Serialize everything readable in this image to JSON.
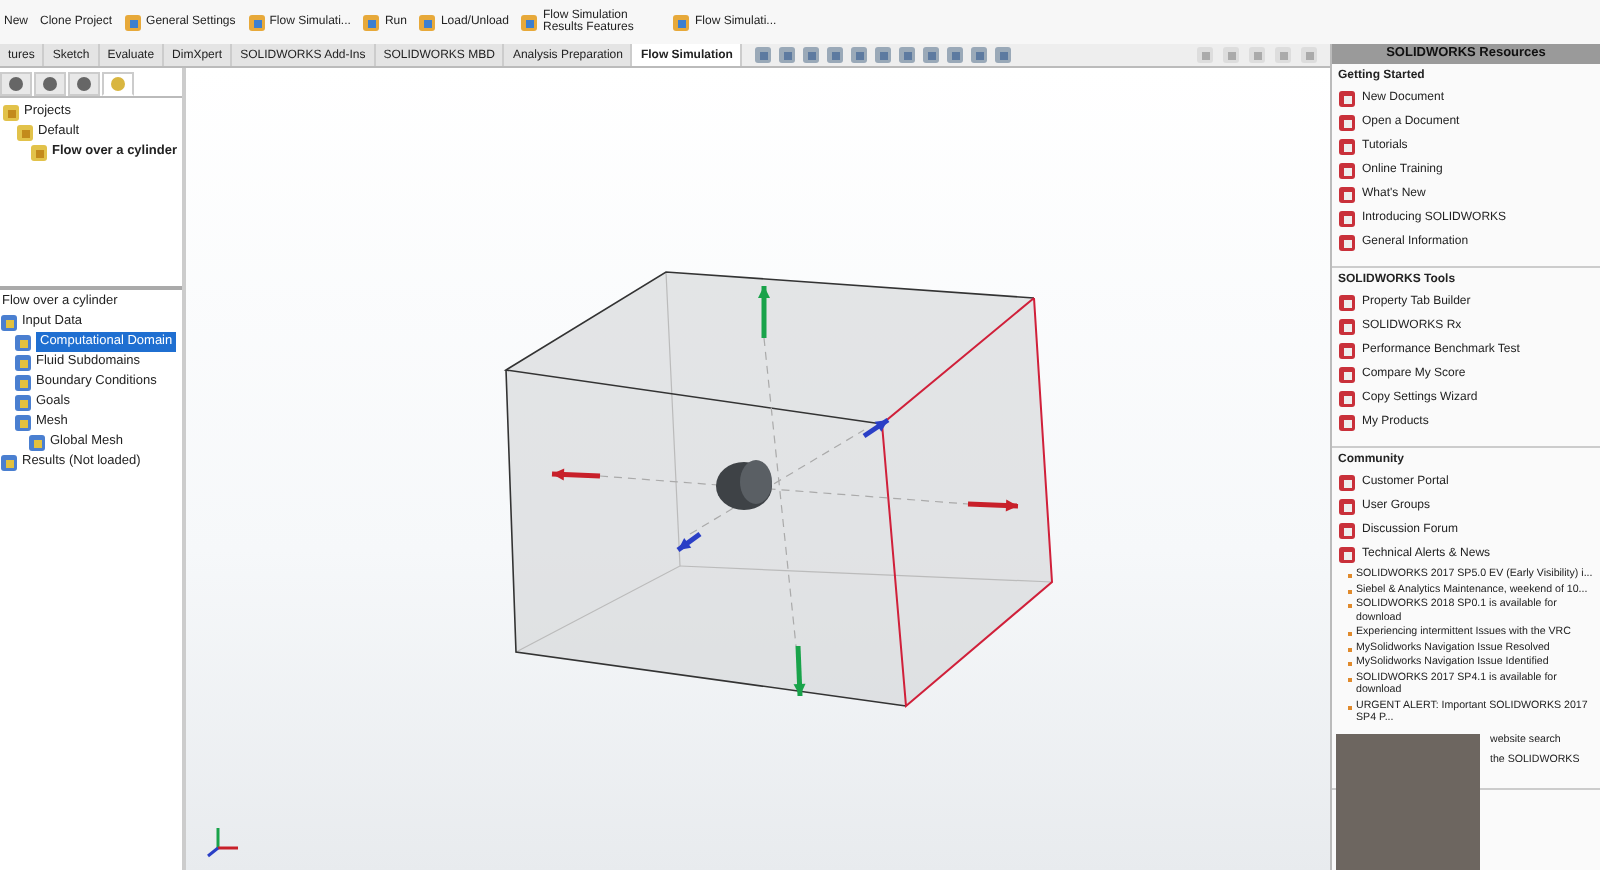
{
  "ribbon": {
    "commands": [
      {
        "label": "New",
        "kind": "small"
      },
      {
        "label": "Clone Project",
        "kind": "small"
      },
      {
        "label": "General Settings",
        "kind": "large"
      },
      {
        "label": "Flow Simulati...",
        "kind": "large"
      },
      {
        "label": "Run",
        "kind": "large"
      },
      {
        "label": "Load/Unload",
        "kind": "large"
      },
      {
        "label": "Flow Simulation Results Features",
        "kind": "large"
      },
      {
        "label": "Flow Simulati...",
        "kind": "large"
      }
    ]
  },
  "tabs": [
    {
      "label": "tures",
      "selected": false
    },
    {
      "label": "Sketch",
      "selected": false
    },
    {
      "label": "Evaluate",
      "selected": false
    },
    {
      "label": "DimXpert",
      "selected": false
    },
    {
      "label": "SOLIDWORKS Add-Ins",
      "selected": false
    },
    {
      "label": "SOLIDWORKS MBD",
      "selected": false
    },
    {
      "label": "Analysis Preparation",
      "selected": false
    },
    {
      "label": "Flow Simulation",
      "selected": true
    }
  ],
  "panel_tabs": [
    {
      "selected": false
    },
    {
      "selected": false
    },
    {
      "selected": false
    },
    {
      "selected": true
    }
  ],
  "projects_tree": [
    {
      "label": "Projects",
      "active": false,
      "children": [
        {
          "label": "Default",
          "active": false,
          "children": [
            {
              "label": "Flow over a cylinder",
              "active": true
            }
          ]
        }
      ]
    }
  ],
  "analysis_tree": {
    "title": "Flow over a cylinder",
    "items": [
      {
        "label": "Input Data",
        "selected": false,
        "children": [
          {
            "label": "Computational Domain",
            "selected": true
          },
          {
            "label": "Fluid Subdomains",
            "selected": false
          },
          {
            "label": "Boundary Conditions",
            "selected": false
          },
          {
            "label": "Goals",
            "selected": false
          },
          {
            "label": "Mesh",
            "selected": false,
            "children": [
              {
                "label": "Global Mesh",
                "selected": false
              }
            ]
          }
        ]
      },
      {
        "label": "Results (Not loaded)",
        "selected": false
      }
    ]
  },
  "resources": {
    "title": "SOLIDWORKS Resources",
    "sections": [
      {
        "title": "Getting Started",
        "items": [
          {
            "label": "New Document"
          },
          {
            "label": "Open a Document"
          },
          {
            "label": "Tutorials"
          },
          {
            "label": "Online Training"
          },
          {
            "label": "What's New"
          },
          {
            "label": "Introducing SOLIDWORKS"
          },
          {
            "label": "General Information"
          }
        ]
      },
      {
        "title": "SOLIDWORKS Tools",
        "items": [
          {
            "label": "Property Tab Builder"
          },
          {
            "label": "SOLIDWORKS Rx"
          },
          {
            "label": "Performance Benchmark Test"
          },
          {
            "label": "Compare My Score"
          },
          {
            "label": "Copy Settings Wizard"
          },
          {
            "label": "My Products"
          }
        ]
      },
      {
        "title": "Community",
        "items": [
          {
            "label": "Customer Portal"
          },
          {
            "label": "User Groups"
          },
          {
            "label": "Discussion Forum"
          },
          {
            "label": "Technical Alerts & News",
            "news": [
              {
                "text": "SOLIDWORKS 2017 SP5.0 EV (Early Visibility) i...",
                "kind": "full"
              },
              {
                "text": "Siebel & Analytics Maintenance, weekend of 10...",
                "kind": "full"
              },
              {
                "text": "SOLIDWORKS 2018 SP0.1 is available for download",
                "kind": "full"
              },
              {
                "text": "Experiencing intermittent Issues with the VRC",
                "kind": "full"
              },
              {
                "text": "MySolidworks Navigation Issue Resolved",
                "kind": "full"
              },
              {
                "text": "MySolidworks Navigation Issue Identified",
                "kind": "full"
              },
              {
                "text": "SOLIDWORKS 2017 SP4.1 is available for download",
                "kind": "full"
              },
              {
                "text": "URGENT ALERT: Important SOLIDWORKS 2017 SP4 P...",
                "kind": "full"
              },
              {
                "text": "website search",
                "kind": "partial"
              },
              {
                "text": "the SOLIDWORKS",
                "kind": "partial"
              }
            ]
          }
        ]
      }
    ]
  }
}
